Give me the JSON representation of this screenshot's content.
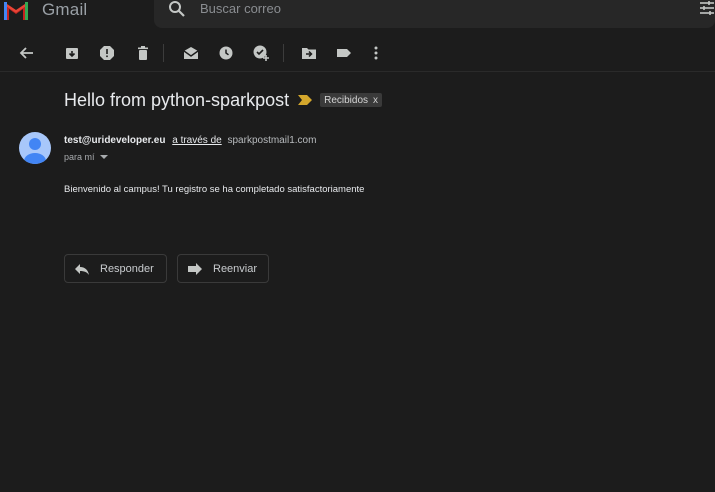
{
  "header": {
    "app_name": "Gmail",
    "search_placeholder": "Buscar correo",
    "logo_icon": "gmail-m-logo",
    "search_icon": "search-icon",
    "filters_icon": "tune-icon"
  },
  "toolbar": {
    "icons": [
      "back-arrow-icon",
      "archive-icon",
      "report-spam-icon",
      "delete-icon",
      "mark-unread-icon",
      "snooze-icon",
      "add-to-tasks-icon",
      "move-to-icon",
      "labels-icon",
      "more-vert-icon"
    ]
  },
  "email": {
    "subject": "Hello from python-sparkpost",
    "label": "Recibidos",
    "label_remove": "x",
    "sender_email": "test@urideveloper.eu",
    "via_text": "a través de",
    "via_domain": "sparkpostmail1.com",
    "to_text": "para mí",
    "body": "Bienvenido al campus! Tu registro se ha completado satisfactoriamente"
  },
  "actions": {
    "reply_label": "Responder",
    "forward_label": "Reenviar"
  },
  "colors": {
    "background": "#1c1c1c",
    "importance_marker": "#d4a72c",
    "avatar": "#a8c7fa",
    "avatar_figure": "#4285f4"
  }
}
